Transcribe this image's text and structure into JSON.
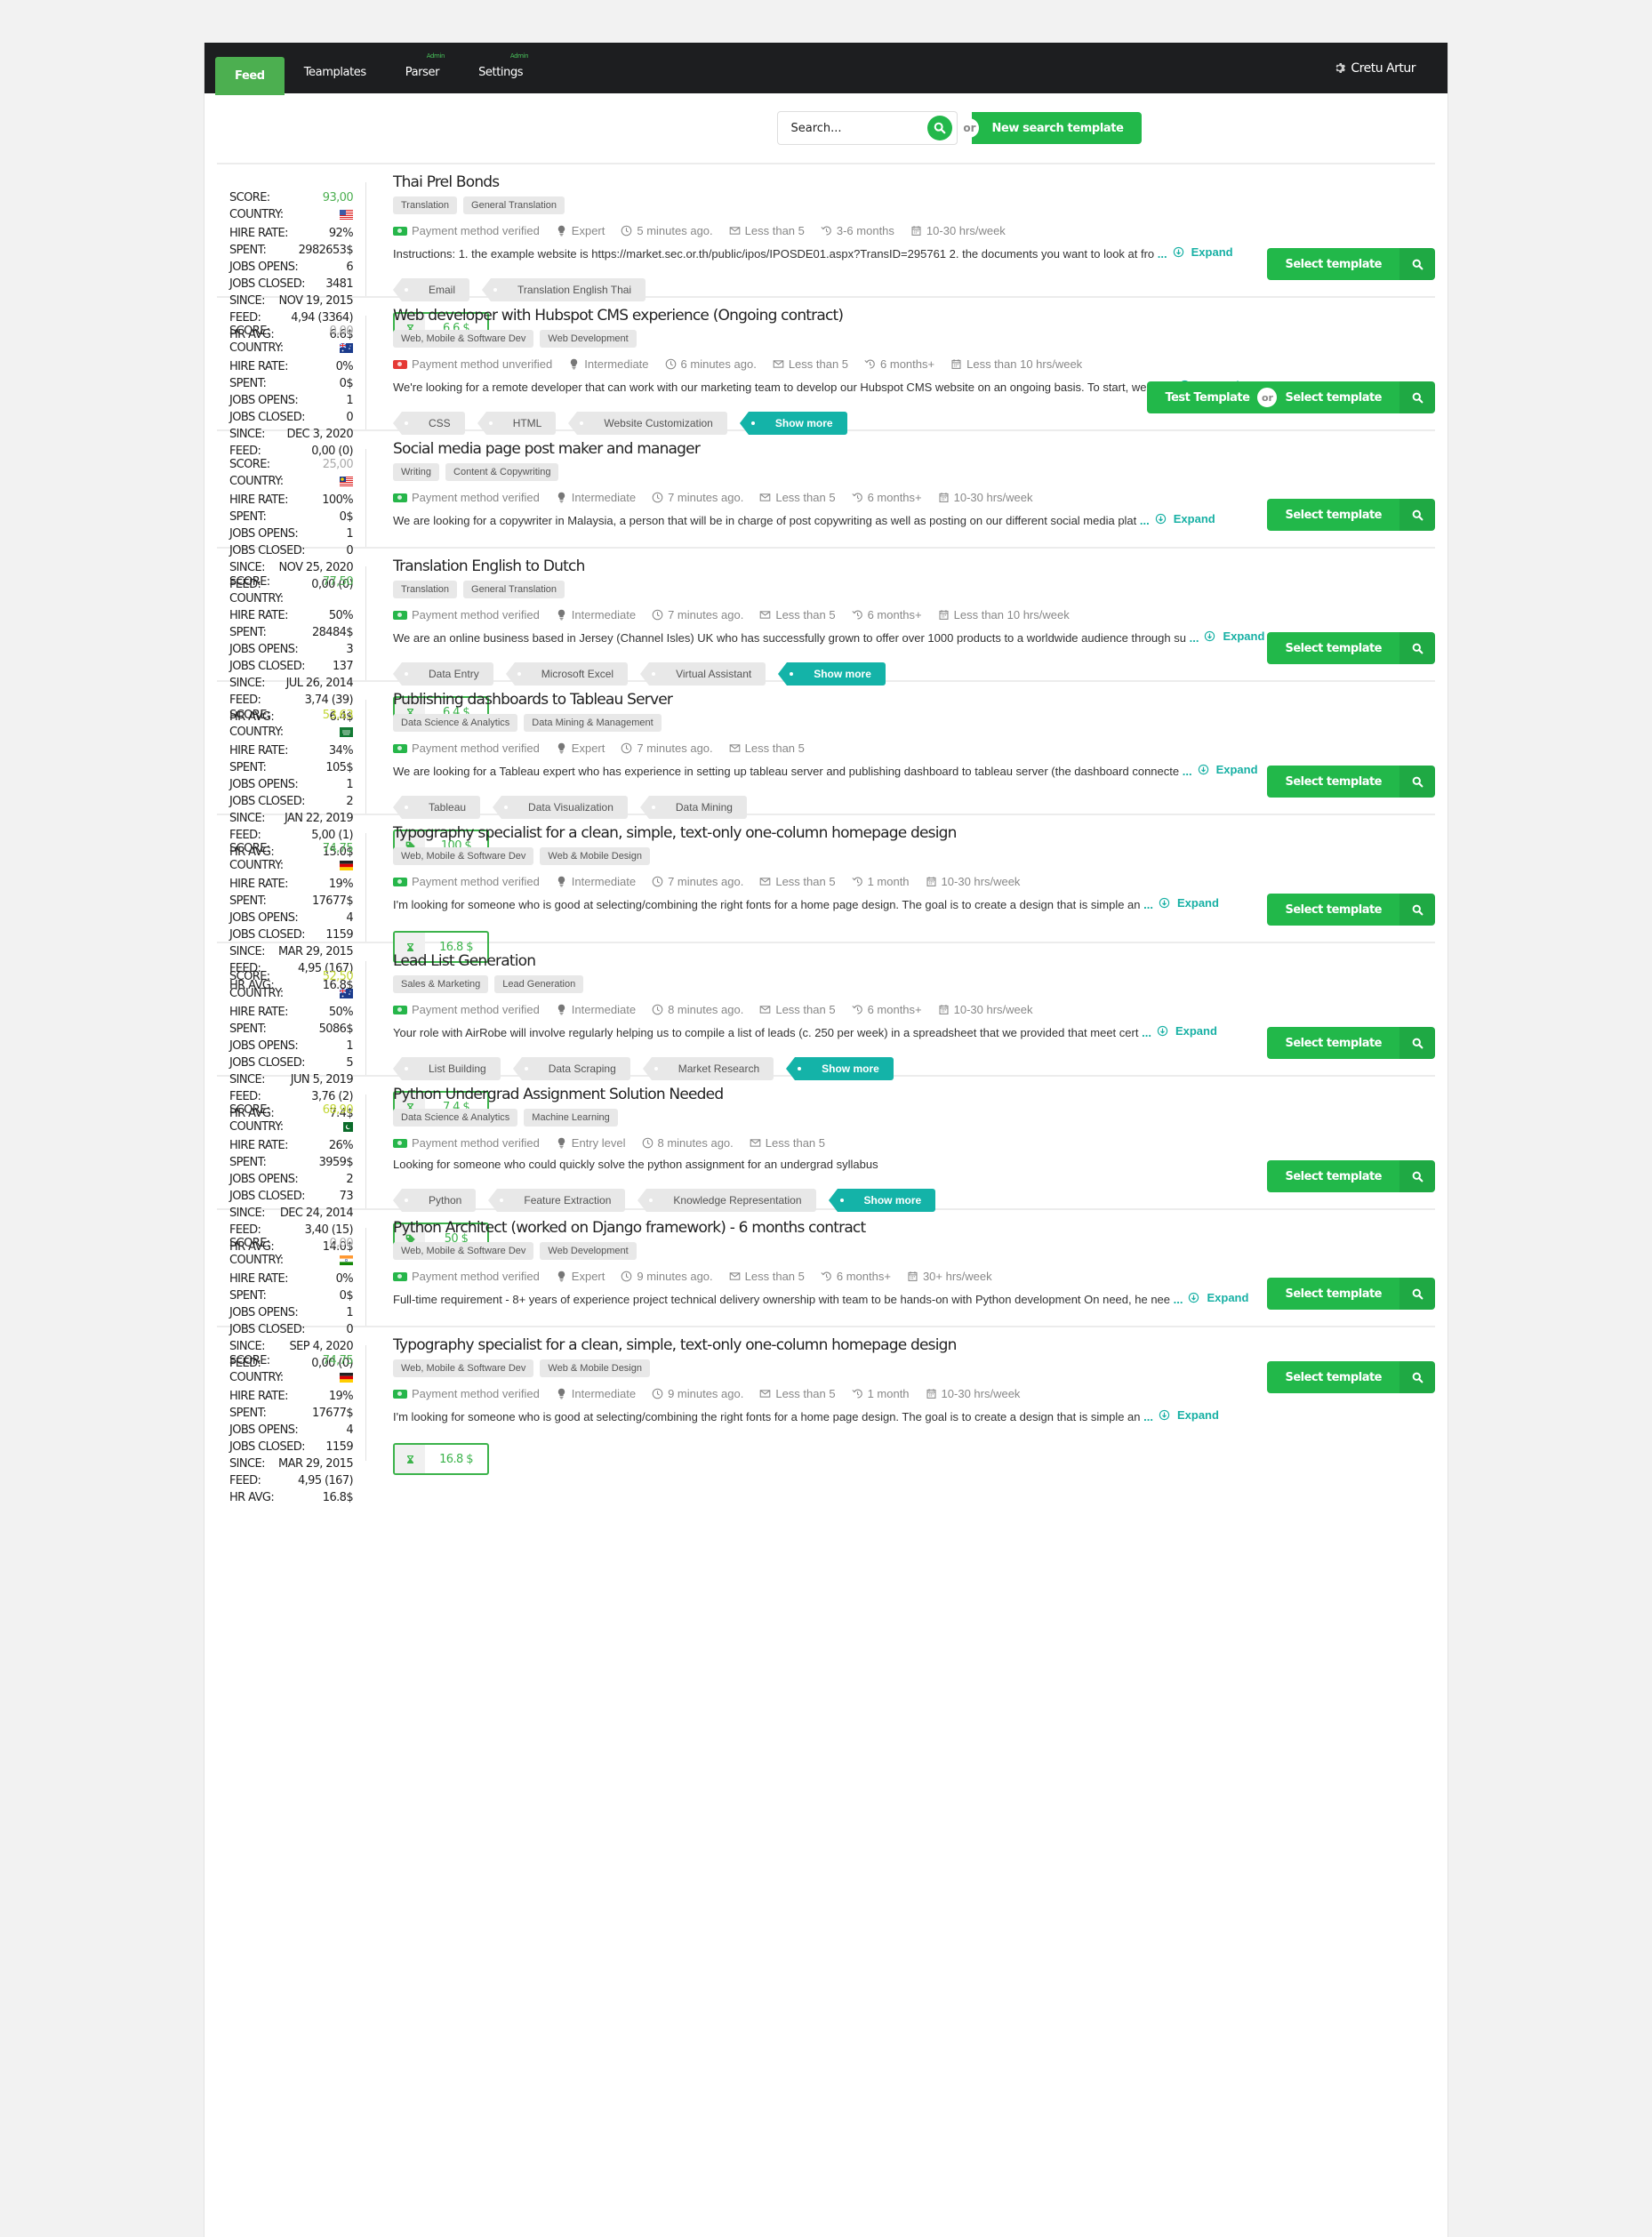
{
  "nav": {
    "items": [
      {
        "label": "Feed",
        "active": true,
        "badge": ""
      },
      {
        "label": "Teamplates",
        "active": false,
        "badge": ""
      },
      {
        "label": "Parser",
        "active": false,
        "badge": "Admin"
      },
      {
        "label": "Settings",
        "active": false,
        "badge": "Admin"
      }
    ],
    "user": "Cretu Artur"
  },
  "search": {
    "placeholder": "Search...",
    "or_label": "or",
    "new_template_label": "New search template"
  },
  "labels": {
    "score": "SCORE:",
    "country": "COUNTRY:",
    "hire_rate": "HIRE RATE:",
    "spent": "SPENT:",
    "jobs_opens": "JOBS OPENS:",
    "jobs_closed": "JOBS CLOSED:",
    "since": "SINCE:",
    "feed": "FEED:",
    "hr_avg": "HR AVG:",
    "expand": "Expand",
    "ellipsis": "...",
    "select_template": "Select template",
    "test_template": "Test Template",
    "or": "or",
    "show_more": "Show more"
  },
  "colors": {
    "accent": "#22b84a",
    "teal": "#14b3a8",
    "score_green": "#4caf50",
    "score_yellow": "#c2d633",
    "score_grey": "#aaaaaa",
    "unverified": "#e53935"
  },
  "jobs": [
    {
      "title": "Thai Prel Bonds",
      "categories": [
        "Translation",
        "General Translation"
      ],
      "stats": {
        "score": "93,00",
        "score_level": "green",
        "country": "US",
        "hire_rate": "92%",
        "spent": "2982653$",
        "jobs_opens": "6",
        "jobs_closed": "3481",
        "since": "NOV 19, 2015",
        "feed": "4,94 (3364)",
        "hr_avg": "6.6$"
      },
      "payment": "Payment method verified",
      "payment_verified": true,
      "level": "Expert",
      "posted": "5 minutes ago.",
      "proposals": "Less than 5",
      "duration": "3-6 months",
      "workload": "10-30 hrs/week",
      "description": "Instructions: 1. the example website is https://market.sec.or.th/public/ipos/IPOSDE01.aspx?TransID=295761 2. the documents you want to look at fro",
      "skills": [
        "Email",
        "Translation English Thai"
      ],
      "show_more": false,
      "price": {
        "type": "hourly",
        "value": "6.6 $"
      },
      "test_template": false
    },
    {
      "title": "Web developer with Hubspot CMS experience (Ongoing contract)",
      "categories": [
        "Web, Mobile & Software Dev",
        "Web Development"
      ],
      "stats": {
        "score": "0,00",
        "score_level": "grey",
        "country": "AU",
        "hire_rate": "0%",
        "spent": "0$",
        "jobs_opens": "1",
        "jobs_closed": "0",
        "since": "DEC 3, 2020",
        "feed": "0,00 (0)",
        "hr_avg": null
      },
      "payment": "Payment method unverified",
      "payment_verified": false,
      "level": "Intermediate",
      "posted": "6 minutes ago.",
      "proposals": "Less than 5",
      "duration": "6 months+",
      "workload": "Less than 10 hrs/week",
      "description": "We're looking for a remote developer that can work with our marketing team to develop our Hubspot CMS website on an ongoing basis. To start, we wi",
      "skills": [
        "CSS",
        "HTML",
        "Website Customization"
      ],
      "show_more": true,
      "price": null,
      "test_template": true
    },
    {
      "title": "Social media page post maker and manager",
      "categories": [
        "Writing",
        "Content & Copywriting"
      ],
      "stats": {
        "score": "25,00",
        "score_level": "grey",
        "country": "MY",
        "hire_rate": "100%",
        "spent": "0$",
        "jobs_opens": "1",
        "jobs_closed": "0",
        "since": "NOV 25, 2020",
        "feed": "0,00 (0)",
        "hr_avg": null
      },
      "payment": "Payment method verified",
      "payment_verified": true,
      "level": "Intermediate",
      "posted": "7 minutes ago.",
      "proposals": "Less than 5",
      "duration": "6 months+",
      "workload": "10-30 hrs/week",
      "description": "We are looking for a copywriter in Malaysia, a person that will be in charge of post copywriting as well as posting on our different social media plat",
      "skills": [],
      "show_more": false,
      "price": null,
      "test_template": false
    },
    {
      "title": "Translation English to Dutch",
      "categories": [
        "Translation",
        "General Translation"
      ],
      "stats": {
        "score": "77,50",
        "score_level": "green",
        "country": "",
        "hire_rate": "50%",
        "spent": "28484$",
        "jobs_opens": "3",
        "jobs_closed": "137",
        "since": "JUL 26, 2014",
        "feed": "3,74 (39)",
        "hr_avg": "6.4$"
      },
      "payment": "Payment method verified",
      "payment_verified": true,
      "level": "Intermediate",
      "posted": "7 minutes ago.",
      "proposals": "Less than 5",
      "duration": "6 months+",
      "workload": "Less than 10 hrs/week",
      "description": "We are an online business based in Jersey (Channel Isles) UK who has successfully grown to offer over 1000 products to a worldwide audience through su",
      "skills": [
        "Data Entry",
        "Microsoft Excel",
        "Virtual Assistant"
      ],
      "show_more": true,
      "price": {
        "type": "hourly",
        "value": "6.4 $"
      },
      "test_template": false
    },
    {
      "title": "Publishing dashboards to Tableau Server",
      "categories": [
        "Data Science & Analytics",
        "Data Mining & Management"
      ],
      "stats": {
        "score": "53,63",
        "score_level": "yellow",
        "country": "SA",
        "hire_rate": "34%",
        "spent": "105$",
        "jobs_opens": "1",
        "jobs_closed": "2",
        "since": "JAN 22, 2019",
        "feed": "5,00 (1)",
        "hr_avg": "15.0$"
      },
      "payment": "Payment method verified",
      "payment_verified": true,
      "level": "Expert",
      "posted": "7 minutes ago.",
      "proposals": "Less than 5",
      "duration": null,
      "workload": null,
      "description": "We are looking for a Tableau expert who has experience in setting up tableau server and publishing dashboard to tableau server (the dashboard connecte",
      "skills": [
        "Tableau",
        "Data Visualization",
        "Data Mining"
      ],
      "show_more": false,
      "price": {
        "type": "fixed",
        "value": "100 $"
      },
      "test_template": false
    },
    {
      "title": "Typography specialist for a clean, simple, text-only one-column homepage design",
      "categories": [
        "Web, Mobile & Software Dev",
        "Web & Mobile Design"
      ],
      "stats": {
        "score": "74,75",
        "score_level": "green",
        "country": "DE",
        "hire_rate": "19%",
        "spent": "17677$",
        "jobs_opens": "4",
        "jobs_closed": "1159",
        "since": "MAR 29, 2015",
        "feed": "4,95 (167)",
        "hr_avg": "16.8$"
      },
      "payment": "Payment method verified",
      "payment_verified": true,
      "level": "Intermediate",
      "posted": "7 minutes ago.",
      "proposals": "Less than 5",
      "duration": "1 month",
      "workload": "10-30 hrs/week",
      "description": "I'm looking for someone who is good at selecting/combining the right fonts for a home page design. The goal is to create a design that is simple an",
      "skills": [],
      "show_more": false,
      "price": {
        "type": "hourly",
        "value": "16.8 $"
      },
      "test_template": false
    },
    {
      "title": "Lead List Generation",
      "categories": [
        "Sales & Marketing",
        "Lead Generation"
      ],
      "stats": {
        "score": "52,50",
        "score_level": "yellow",
        "country": "AU",
        "hire_rate": "50%",
        "spent": "5086$",
        "jobs_opens": "1",
        "jobs_closed": "5",
        "since": "JUN 5, 2019",
        "feed": "3,76 (2)",
        "hr_avg": "7.4$"
      },
      "payment": "Payment method verified",
      "payment_verified": true,
      "level": "Intermediate",
      "posted": "8 minutes ago.",
      "proposals": "Less than 5",
      "duration": "6 months+",
      "workload": "10-30 hrs/week",
      "description": "Your role with AirRobe will involve regularly helping us to compile a list of leads (c. 250 per week) in a spreadsheet that we provided that meet cert",
      "skills": [
        "List Building",
        "Data Scraping",
        "Market Research"
      ],
      "show_more": true,
      "price": {
        "type": "hourly",
        "value": "7.4 $"
      },
      "test_template": false
    },
    {
      "title": "Python Undergrad Assignment Solution Needed",
      "categories": [
        "Data Science & Analytics",
        "Machine Learning"
      ],
      "stats": {
        "score": "68,90",
        "score_level": "yellow",
        "country": "PK",
        "hire_rate": "26%",
        "spent": "3959$",
        "jobs_opens": "2",
        "jobs_closed": "73",
        "since": "DEC 24, 2014",
        "feed": "3,40 (15)",
        "hr_avg": "14.0$"
      },
      "payment": "Payment method verified",
      "payment_verified": true,
      "level": "Entry level",
      "posted": "8 minutes ago.",
      "proposals": "Less than 5",
      "duration": null,
      "workload": null,
      "description": "Looking for someone who could quickly solve the python assignment for an undergrad syllabus",
      "description_truncated": false,
      "skills": [
        "Python",
        "Feature Extraction",
        "Knowledge Representation"
      ],
      "show_more": true,
      "price": {
        "type": "fixed",
        "value": "50 $"
      },
      "test_template": false
    },
    {
      "title": "Python Architect (worked on Django framework) - 6 months contract",
      "categories": [
        "Web, Mobile & Software Dev",
        "Web Development"
      ],
      "stats": {
        "score": "0,00",
        "score_level": "grey",
        "country": "IN",
        "hire_rate": "0%",
        "spent": "0$",
        "jobs_opens": "1",
        "jobs_closed": "0",
        "since": "SEP 4, 2020",
        "feed": "0,00 (0)",
        "hr_avg": null
      },
      "payment": "Payment method verified",
      "payment_verified": true,
      "level": "Expert",
      "posted": "9 minutes ago.",
      "proposals": "Less than 5",
      "duration": "6 months+",
      "workload": "30+ hrs/week",
      "description": "Full-time requirement - 8+ years of experience project technical delivery ownership with team to be hands-on with Python development On need, he nee",
      "skills": [],
      "show_more": false,
      "price": null,
      "test_template": false
    },
    {
      "title": "Typography specialist for a clean, simple, text-only one-column homepage design",
      "categories": [
        "Web, Mobile & Software Dev",
        "Web & Mobile Design"
      ],
      "stats": {
        "score": "74,75",
        "score_level": "green",
        "country": "DE",
        "hire_rate": "19%",
        "spent": "17677$",
        "jobs_opens": "4",
        "jobs_closed": "1159",
        "since": "MAR 29, 2015",
        "feed": "4,95 (167)",
        "hr_avg": "16.8$"
      },
      "payment": "Payment method verified",
      "payment_verified": true,
      "level": "Intermediate",
      "posted": "9 minutes ago.",
      "proposals": "Less than 5",
      "duration": "1 month",
      "workload": "10-30 hrs/week",
      "description": "I'm looking for someone who is good at selecting/combining the right fonts for a home page design. The goal is to create a design that is simple an",
      "skills": [],
      "show_more": false,
      "price": {
        "type": "hourly",
        "value": "16.8 $"
      },
      "test_template": false
    }
  ]
}
